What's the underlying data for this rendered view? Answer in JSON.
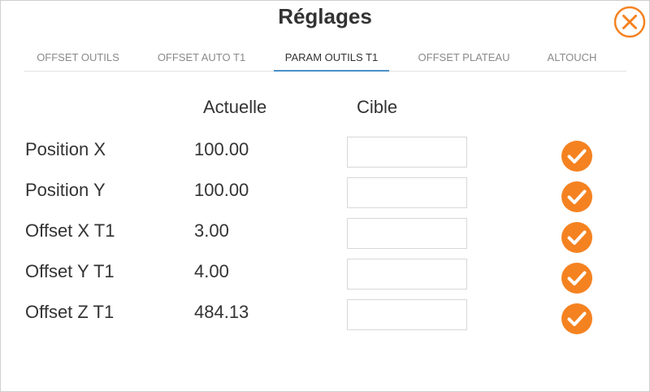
{
  "dialog": {
    "title": "Réglages",
    "close_icon": "close-x-circle-icon"
  },
  "tabs": [
    {
      "label": "OFFSET OUTILS",
      "active": false
    },
    {
      "label": "OFFSET AUTO T1",
      "active": false
    },
    {
      "label": "PARAM OUTILS T1",
      "active": true
    },
    {
      "label": "OFFSET PLATEAU",
      "active": false
    },
    {
      "label": "ALTOUCH",
      "active": false
    }
  ],
  "table": {
    "headers": {
      "current": "Actuelle",
      "target": "Cible"
    },
    "rows": [
      {
        "label": "Position X",
        "current": "100.00",
        "target": ""
      },
      {
        "label": "Position Y",
        "current": "100.00",
        "target": ""
      },
      {
        "label": "Offset X T1",
        "current": "3.00",
        "target": ""
      },
      {
        "label": "Offset Y T1",
        "current": "4.00",
        "target": ""
      },
      {
        "label": "Offset Z T1",
        "current": "484.13",
        "target": ""
      }
    ],
    "confirm_icon": "check-circle-icon"
  },
  "colors": {
    "accent": "#f58220",
    "tab_active_underline": "#4a90c8",
    "text": "#333333",
    "tab_inactive": "#8a8a8a"
  }
}
